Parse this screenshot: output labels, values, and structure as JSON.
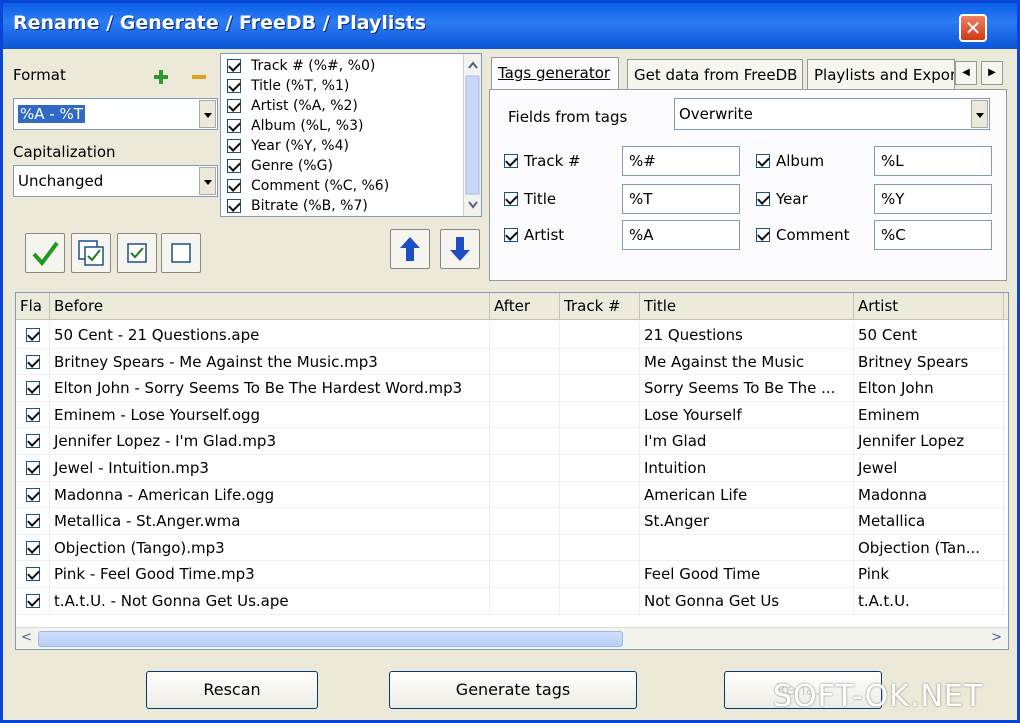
{
  "window": {
    "title": "Rename / Generate / FreeDB / Playlists",
    "close_glyph": "✕"
  },
  "format": {
    "label": "Format",
    "value": "%A - %T",
    "add_icon": "plus-icon",
    "remove_icon": "minus-icon"
  },
  "capitalization": {
    "label": "Capitalization",
    "value": "Unchanged"
  },
  "field_list": [
    {
      "label": "Track # (%#, %0)",
      "checked": true
    },
    {
      "label": "Title (%T, %1)",
      "checked": true
    },
    {
      "label": "Artist (%A, %2)",
      "checked": true
    },
    {
      "label": "Album (%L, %3)",
      "checked": true
    },
    {
      "label": "Year (%Y, %4)",
      "checked": true
    },
    {
      "label": "Genre (%G)",
      "checked": true
    },
    {
      "label": "Comment (%C, %6)",
      "checked": true
    },
    {
      "label": "Bitrate (%B, %7)",
      "checked": true
    }
  ],
  "tabs": [
    "Tags generator",
    "Get data from FreeDB",
    "Playlists and Export"
  ],
  "tags_generator": {
    "fields_from_tags_label": "Fields from tags",
    "fields_from_tags_value": "Overwrite",
    "rows": [
      {
        "label": "Track #",
        "value": "%#"
      },
      {
        "label": "Title",
        "value": "%T"
      },
      {
        "label": "Artist",
        "value": "%A"
      },
      {
        "label": "Album",
        "value": "%L"
      },
      {
        "label": "Year",
        "value": "%Y"
      },
      {
        "label": "Comment",
        "value": "%C"
      }
    ]
  },
  "grid": {
    "headers": [
      "Fla",
      "Before",
      "After",
      "Track #",
      "Title",
      "Artist"
    ],
    "rows": [
      {
        "before": "50 Cent - 21 Questions.ape",
        "after": "",
        "track": "",
        "title": "21 Questions",
        "artist": "50 Cent"
      },
      {
        "before": "Britney Spears - Me Against the Music.mp3",
        "after": "",
        "track": "",
        "title": "Me Against the Music",
        "artist": "Britney Spears"
      },
      {
        "before": "Elton John - Sorry Seems To Be The Hardest Word.mp3",
        "after": "",
        "track": "",
        "title": "Sorry Seems To Be The ...",
        "artist": "Elton John"
      },
      {
        "before": "Eminem - Lose Yourself.ogg",
        "after": "",
        "track": "",
        "title": "Lose Yourself",
        "artist": "Eminem"
      },
      {
        "before": "Jennifer Lopez - I'm Glad.mp3",
        "after": "",
        "track": "",
        "title": "I'm Glad",
        "artist": "Jennifer Lopez"
      },
      {
        "before": "Jewel - Intuition.mp3",
        "after": "",
        "track": "",
        "title": "Intuition",
        "artist": "Jewel"
      },
      {
        "before": "Madonna - American Life.ogg",
        "after": "",
        "track": "",
        "title": "American Life",
        "artist": "Madonna"
      },
      {
        "before": "Metallica - St.Anger.wma",
        "after": "",
        "track": "",
        "title": "St.Anger",
        "artist": "Metallica"
      },
      {
        "before": "Objection (Tango).mp3",
        "after": "",
        "track": "",
        "title": "",
        "artist": "Objection (Tan..."
      },
      {
        "before": "Pink - Feel Good Time.mp3",
        "after": "",
        "track": "",
        "title": "Feel Good Time",
        "artist": "Pink"
      },
      {
        "before": "t.A.t.U. - Not Gonna Get Us.ape",
        "after": "",
        "track": "",
        "title": "Not Gonna Get Us",
        "artist": "t.A.t.U."
      }
    ]
  },
  "buttons": {
    "rescan": "Rescan",
    "generate": "Generate tags",
    "third": "Rena..."
  },
  "watermark": "SOFT-OK.NET",
  "colors": {
    "titlebar": "#0a5fe8",
    "selection": "#316ac5",
    "close": "#d03814"
  }
}
